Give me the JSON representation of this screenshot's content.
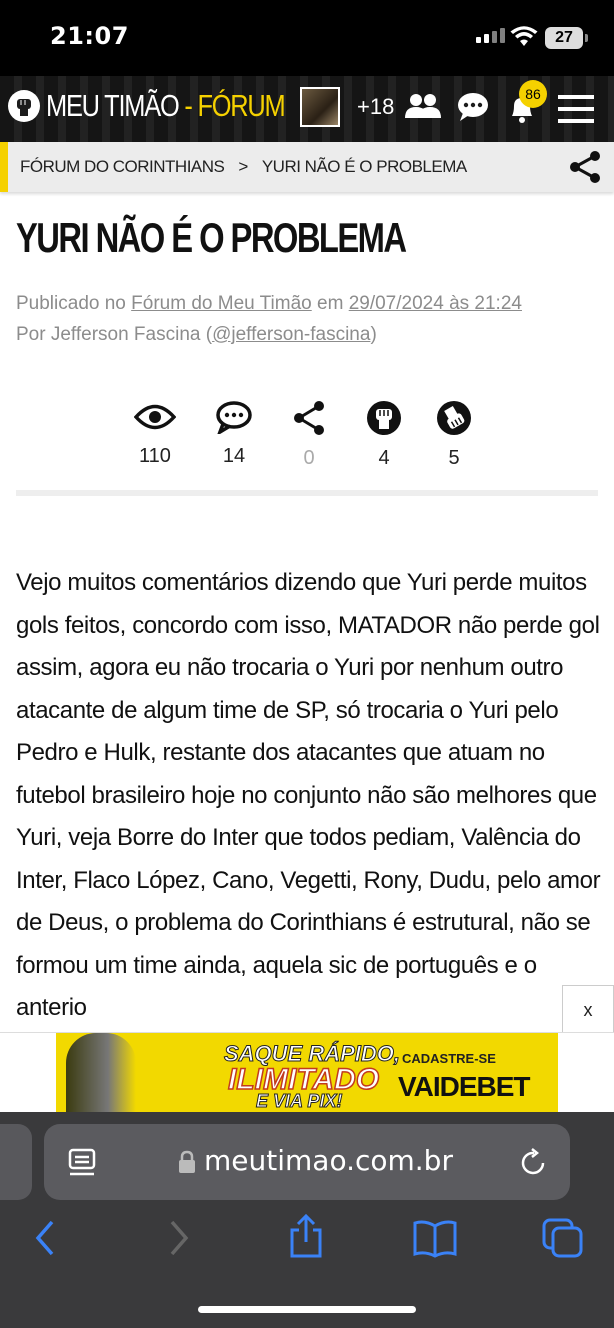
{
  "status_bar": {
    "time": "21:07",
    "battery": "27"
  },
  "header": {
    "brand": "MEU TIMÃO",
    "separator": "-",
    "brand_suffix": "FÓRUM",
    "online_count": "+18",
    "notifications_count": "86"
  },
  "breadcrumb": {
    "items": [
      "FÓRUM DO CORINTHIANS",
      "YURI NÃO É O PROBLEMA"
    ],
    "separator": ">"
  },
  "post": {
    "title": "YURI NÃO É O PROBLEMA",
    "published_prefix": "Publicado no",
    "forum_link": "Fórum do Meu Timão",
    "date_prefix": "em",
    "date_link": "29/07/2024 às 21:24",
    "author_prefix": "Por Jefferson Fascina (",
    "author_handle": "@jefferson-fascina",
    "author_suffix": ")",
    "body": "Vejo muitos comentários dizendo que Yuri perde muitos gols feitos, concordo com isso, MATADOR não perde gol assim, agora eu não trocaria o Yuri por nenhum outro atacante de algum time de SP, só trocaria o Yuri pelo Pedro e Hulk, restante dos atacantes que atuam no futebol brasileiro hoje no conjunto não são melhores que Yuri, veja Borre do Inter que todos pediam, Valência do Inter, Flaco López, Cano, Vegetti, Rony, Dudu, pelo amor de Deus, o problema do Corinthians é estrutural, não se formou um time ainda, aquela sic de português e o anterio"
  },
  "stats": {
    "views": "110",
    "comments": "14",
    "shares": "0",
    "likes": "4",
    "dislikes": "5"
  },
  "ad": {
    "line1": "SAQUE RÁPIDO,",
    "line2": "ILIMITADO",
    "line3": "E VIA PIX!",
    "cta": "CADASTRE-SE",
    "brand": "VAIDEBET",
    "close": "x"
  },
  "browser": {
    "url": "meutimao.com.br"
  },
  "colors": {
    "accent": "#f5d100",
    "header_bg": "#1c1c1c",
    "safari_bg": "#3a3a3c",
    "ios_blue": "#3a82f7"
  }
}
